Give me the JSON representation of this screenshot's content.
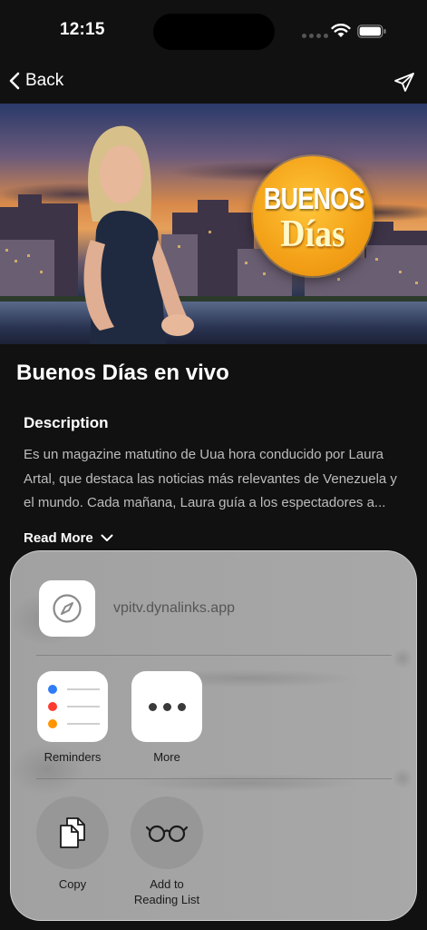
{
  "status_bar": {
    "time": "12:15"
  },
  "nav": {
    "back_label": "Back"
  },
  "hero": {
    "logo_line1": "BUENOS",
    "logo_line2": "Días"
  },
  "show": {
    "title": "Buenos Días en vivo",
    "description_heading": "Description",
    "description_text": "Es un magazine matutino de Uua hora conducido por Laura Artal, que destaca las noticias más relevantes de Venezuela y el mundo. Cada mañana, Laura guía a los espectadores a...",
    "read_more_label": "Read More"
  },
  "share_sheet": {
    "url": "vpitv.dynalinks.app",
    "apps": [
      {
        "label": "Reminders",
        "icon": "reminders-icon"
      },
      {
        "label": "More",
        "icon": "more-icon"
      }
    ],
    "actions": [
      {
        "label": "Copy",
        "icon": "copy-icon"
      },
      {
        "label": "Add to\nReading List",
        "icon": "reading-glasses-icon"
      }
    ]
  },
  "colors": {
    "background": "#111111",
    "sheet": "#a7a7a7",
    "accent_orange": "#f4a319"
  }
}
